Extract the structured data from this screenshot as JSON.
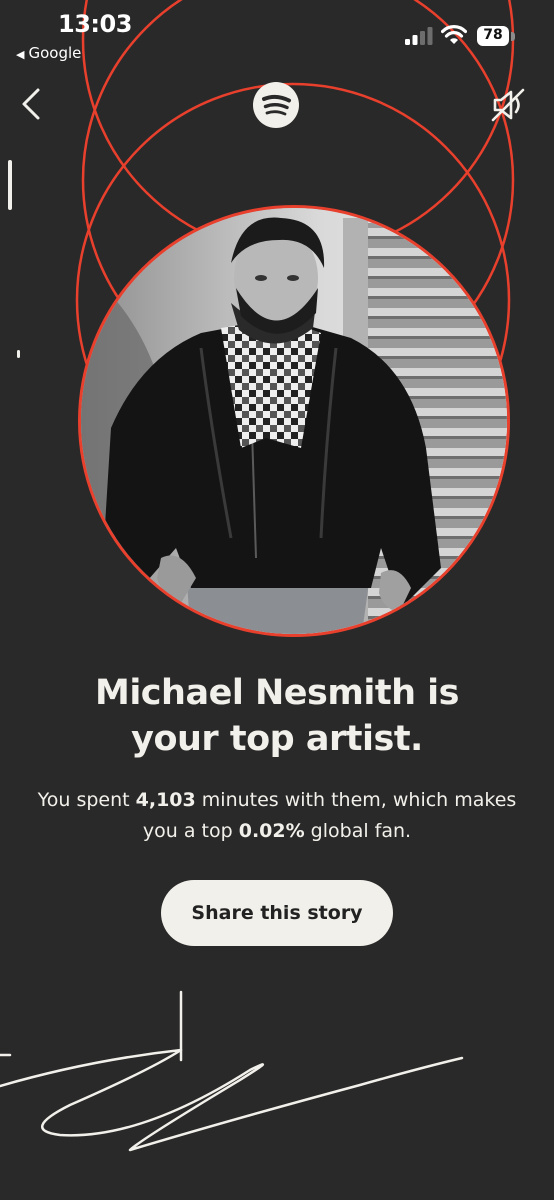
{
  "status_bar": {
    "time": "13:03",
    "back_app_label": "Google",
    "battery_level": "78",
    "signal_bars": 2,
    "signal_total": 4
  },
  "header": {
    "back_icon": "chevron-left-icon",
    "logo_icon": "spotify-logo-icon",
    "sound_icon": "speaker-muted-icon"
  },
  "story": {
    "headline_line1": "Michael Nesmith is",
    "headline_line2": "your top artist.",
    "sub_prefix": "You spent ",
    "minutes": "4,103",
    "sub_middle": " minutes with them, which makes you a top ",
    "percentile": "0.02%",
    "sub_suffix": " global fan.",
    "share_label": "Share this story"
  },
  "colors": {
    "background": "#2a2929",
    "ring": "#e8402d",
    "text": "#f2f0ea",
    "button_bg": "#f2f0ea",
    "button_text": "#222222"
  }
}
